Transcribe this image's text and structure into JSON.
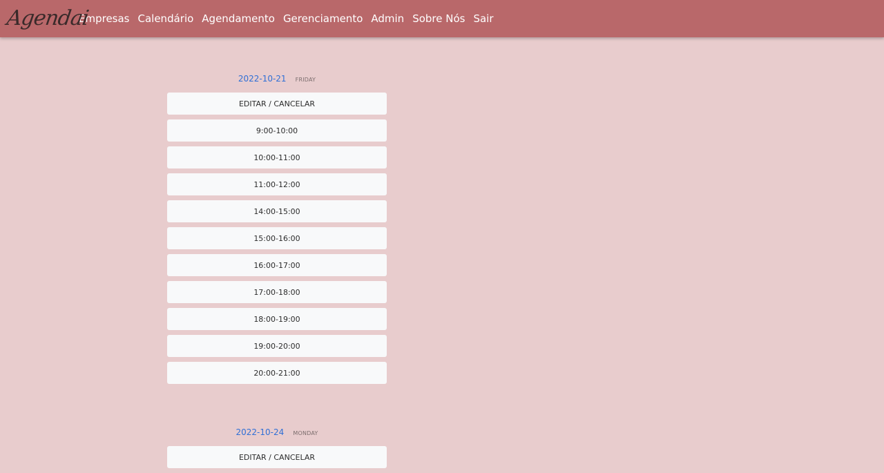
{
  "navbar": {
    "logo": "Agendai",
    "links": [
      "Empresas",
      "Calendário",
      "Agendamento",
      "Gerenciamento",
      "Admin",
      "Sobre Nós",
      "Sair"
    ]
  },
  "days": [
    {
      "date": "2022-10-21",
      "weekday": "FRIDAY",
      "edit_label": "EDITAR / CANCELAR",
      "slots": [
        "9:00-10:00",
        "10:00-11:00",
        "11:00-12:00",
        "14:00-15:00",
        "15:00-16:00",
        "16:00-17:00",
        "17:00-18:00",
        "18:00-19:00",
        "19:00-20:00",
        "20:00-21:00"
      ]
    },
    {
      "date": "2022-10-24",
      "weekday": "MONDAY",
      "edit_label": "EDITAR / CANCELAR",
      "slots": []
    }
  ],
  "colors": {
    "navbar": "#b9686a",
    "background": "#e8cccd",
    "date_link": "#2f6fd6",
    "slot_bg": "#f8f9fa"
  }
}
